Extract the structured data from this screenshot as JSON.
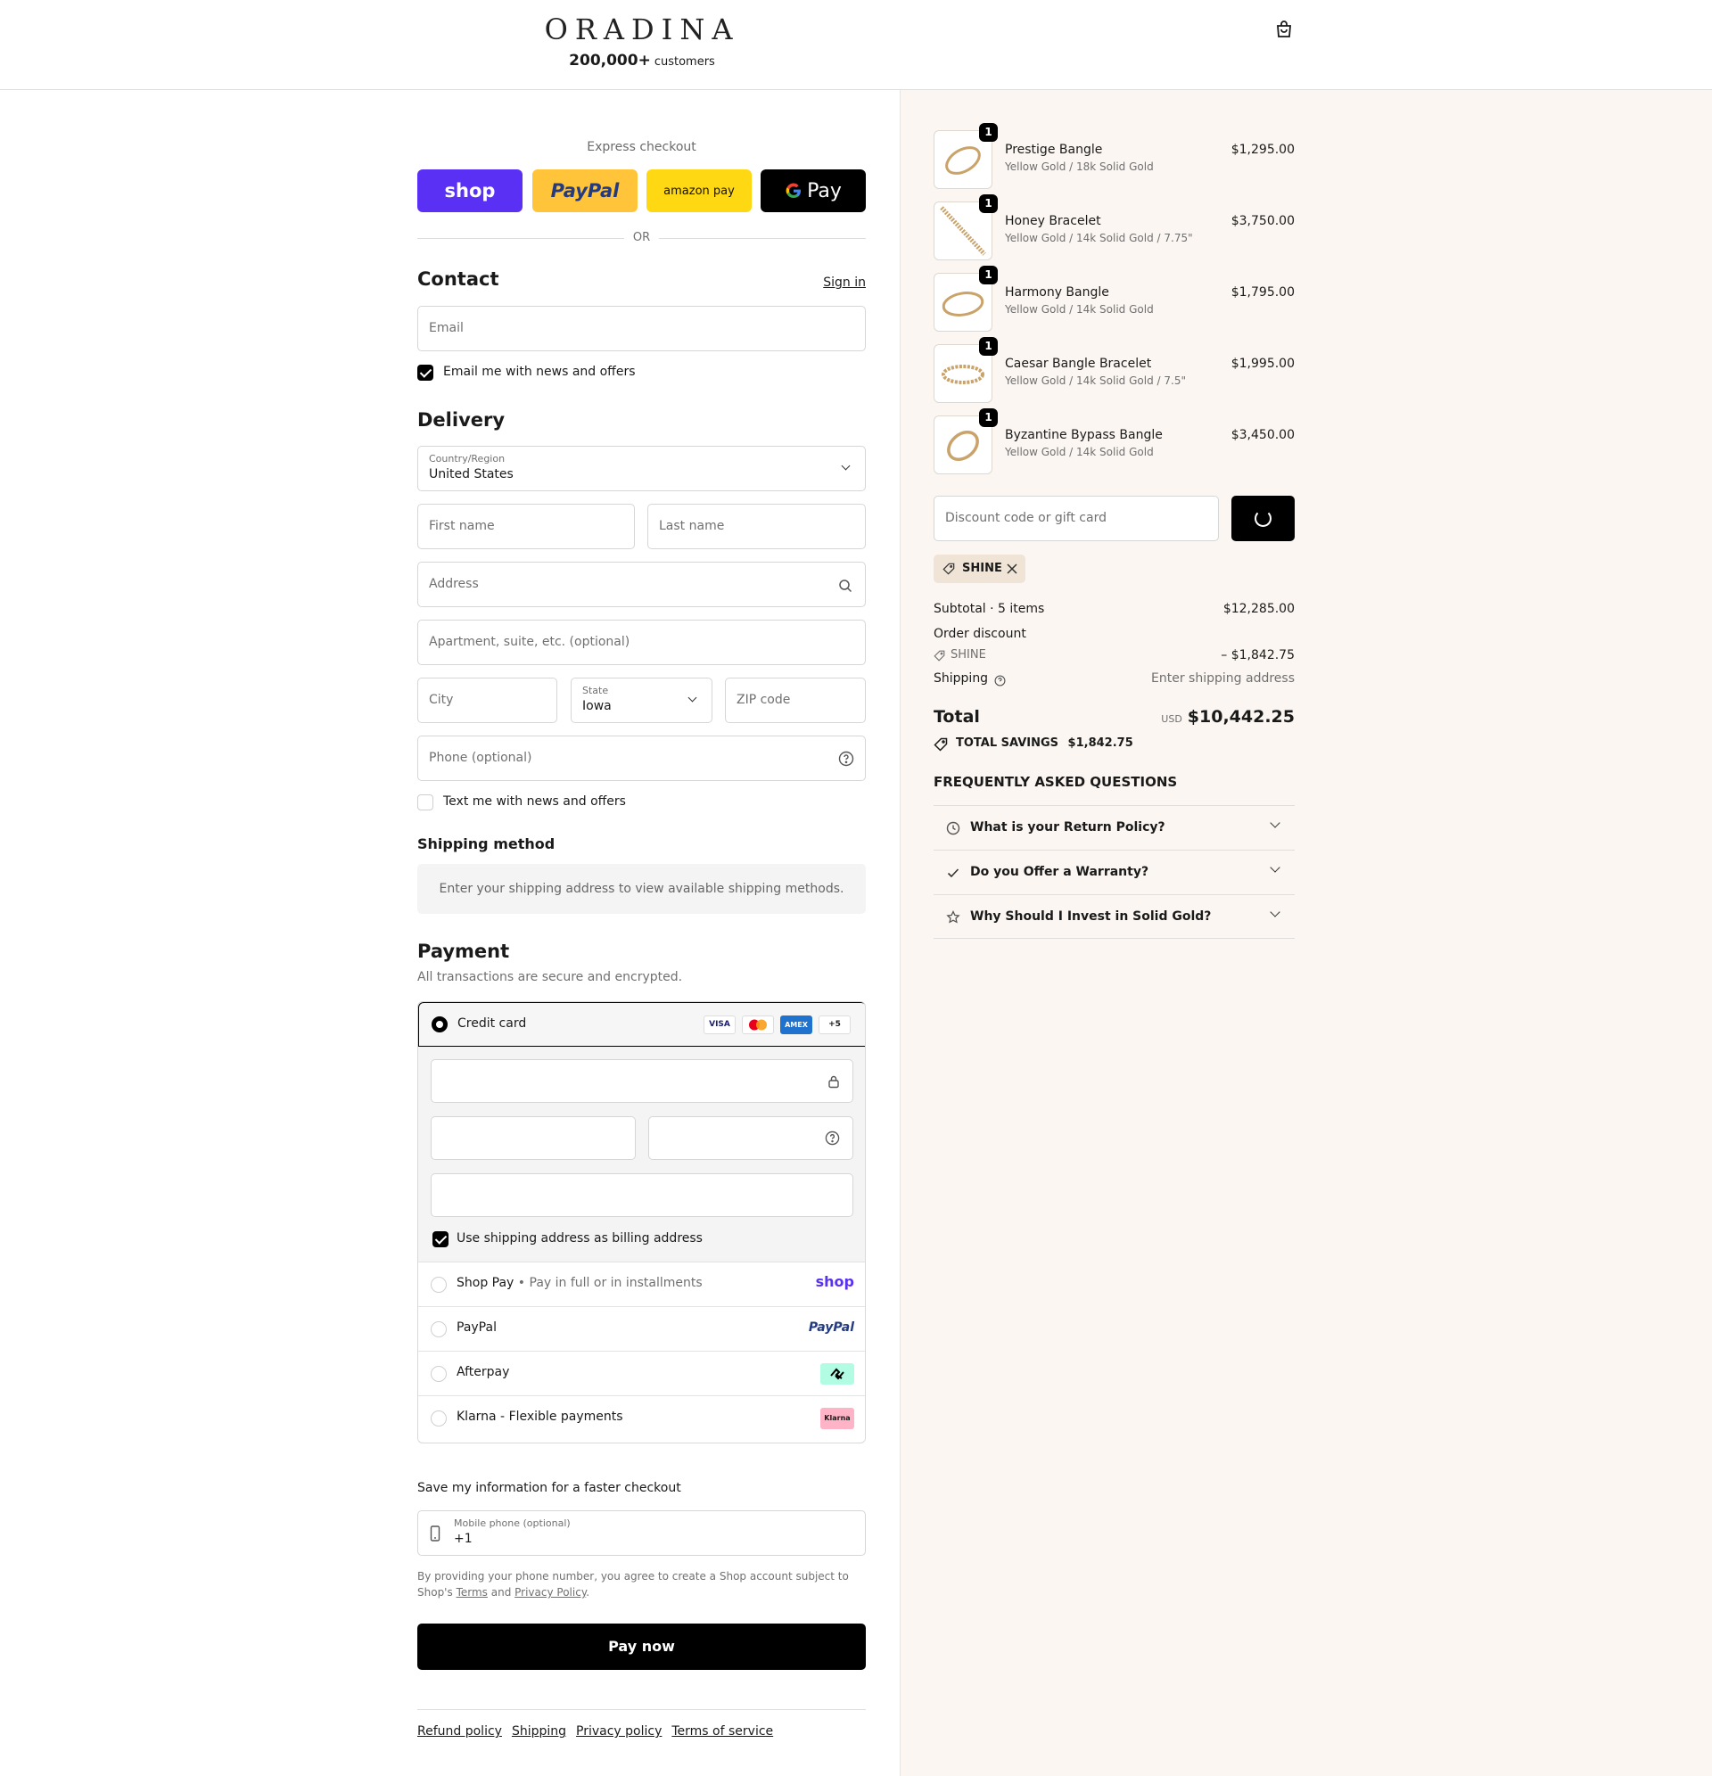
{
  "header": {
    "logo": "ORADINA",
    "social_count": "200,000+",
    "social_label": "customers"
  },
  "express": {
    "label": "Express checkout",
    "buttons": [
      "shop",
      "PayPal",
      "amazon pay",
      "Pay"
    ],
    "or": "OR"
  },
  "contact": {
    "title": "Contact",
    "sign_in": "Sign in",
    "email_placeholder": "Email",
    "news_label": "Email me with news and offers",
    "news_checked": true
  },
  "delivery": {
    "title": "Delivery",
    "country_label": "Country/Region",
    "country_value": "United States",
    "first_name": "First name",
    "last_name": "Last name",
    "address": "Address",
    "apartment": "Apartment, suite, etc. (optional)",
    "city": "City",
    "state_label": "State",
    "state_value": "Iowa",
    "zip": "ZIP code",
    "phone": "Phone (optional)",
    "text_label": "Text me with news and offers",
    "text_checked": false
  },
  "shipping_method": {
    "title": "Shipping method",
    "message": "Enter your shipping address to view available shipping methods."
  },
  "payment": {
    "title": "Payment",
    "subtitle": "All transactions are secure and encrypted.",
    "credit_card": "Credit card",
    "card_brands": [
      "VISA",
      "Mastercard",
      "AMEX",
      "+5"
    ],
    "billing_label": "Use shipping address as billing address",
    "billing_checked": true,
    "options": [
      {
        "name": "Shop Pay",
        "sub": "Pay in full or in installments",
        "logo": "shop"
      },
      {
        "name": "PayPal",
        "logo": "PayPal"
      },
      {
        "name": "Afterpay",
        "logo": "afterpay-icon"
      },
      {
        "name": "Klarna - Flexible payments",
        "logo": "Klarna"
      }
    ]
  },
  "save": {
    "title": "Save my information for a faster checkout",
    "mobile_label": "Mobile phone (optional)",
    "mobile_value": "+1",
    "consent_pre": "By providing your phone number, you agree to create a Shop account subject to Shop's",
    "terms": "Terms",
    "and": "and",
    "privacy": "Privacy Policy"
  },
  "pay_now": "Pay now",
  "footer_links": [
    "Refund policy",
    "Shipping",
    "Privacy policy",
    "Terms of service"
  ],
  "items": [
    {
      "name": "Prestige Bangle",
      "variant": "Yellow Gold / 18k Solid Gold",
      "price": "$1,295.00",
      "qty": "1"
    },
    {
      "name": "Honey Bracelet",
      "variant": "Yellow Gold / 14k Solid Gold / 7.75\"",
      "price": "$3,750.00",
      "qty": "1"
    },
    {
      "name": "Harmony Bangle",
      "variant": "Yellow Gold / 14k Solid Gold",
      "price": "$1,795.00",
      "qty": "1"
    },
    {
      "name": "Caesar Bangle Bracelet",
      "variant": "Yellow Gold / 14k Solid Gold / 7.5\"",
      "price": "$1,995.00",
      "qty": "1"
    },
    {
      "name": "Byzantine Bypass Bangle",
      "variant": "Yellow Gold / 14k Solid Gold",
      "price": "$3,450.00",
      "qty": "1"
    }
  ],
  "discount": {
    "placeholder": "Discount code or gift card",
    "code": "SHINE"
  },
  "summary": {
    "subtotal_label": "Subtotal · 5 items",
    "subtotal": "$12,285.00",
    "order_discount": "Order discount",
    "discount_code": "SHINE",
    "discount_amount": "– $1,842.75",
    "shipping_label": "Shipping",
    "shipping_value": "Enter shipping address",
    "total_label": "Total",
    "currency": "USD",
    "total": "$10,442.25",
    "savings_label": "TOTAL SAVINGS",
    "savings": "$1,842.75"
  },
  "faq": {
    "title": "FREQUENTLY ASKED QUESTIONS",
    "questions": [
      "What is your Return Policy?",
      "Do you Offer a Warranty?",
      "Why Should I Invest in Solid Gold?"
    ]
  },
  "colors": {
    "shop": "#5a31f4",
    "paypal_bg": "#ffc439",
    "amazon_bg": "#ffd814",
    "summary_bg": "#fbf6f1",
    "tag_bg": "#efe4d6",
    "gold": "#c9a36a"
  }
}
